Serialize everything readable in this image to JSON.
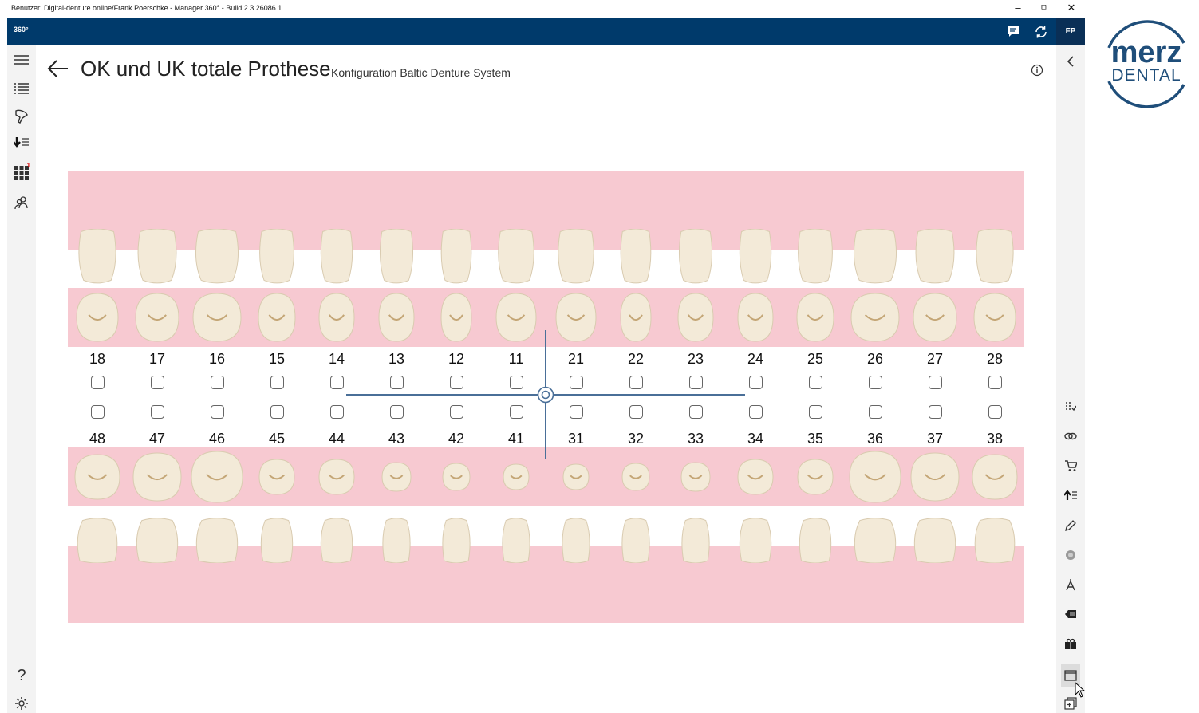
{
  "window": {
    "title": "Benutzer: Digital-denture.online/Frank Poerschke - Manager 360° - Build 2.3.26086.1",
    "controls": [
      "–",
      "⧉",
      "✕"
    ]
  },
  "appbar": {
    "logo_text": "360°",
    "user_initials": "FP",
    "icons": [
      "chat-icon",
      "sync-icon"
    ],
    "background": "#003a6b"
  },
  "left_rail": {
    "icons": [
      "hamburger-menu-icon",
      "list-icon",
      "dental-brush-icon",
      "download-list-icon",
      "grid-apps-icon",
      "users-icon",
      "help-icon",
      "settings-gear-icon"
    ],
    "grid_badge": "1"
  },
  "header": {
    "title": "OK und UK totale Prothese",
    "subtitle": "Konfiguration Baltic Denture System"
  },
  "upper_numbers": [
    "18",
    "17",
    "16",
    "15",
    "14",
    "13",
    "12",
    "11",
    "21",
    "22",
    "23",
    "24",
    "25",
    "26",
    "27",
    "28"
  ],
  "lower_numbers": [
    "48",
    "47",
    "46",
    "45",
    "44",
    "43",
    "42",
    "41",
    "31",
    "32",
    "33",
    "34",
    "35",
    "36",
    "37",
    "38"
  ],
  "right_rail": {
    "icons": [
      "collapse-chevron-icon",
      "checklist-icon",
      "link-icon",
      "cart-icon",
      "upload-list-icon",
      "edit-pencil-icon",
      "scan-icon",
      "compass-icon",
      "label-icon",
      "gift-icon",
      "window-icon",
      "add-window-icon"
    ]
  },
  "brand": {
    "merz": "merz",
    "dental": "DENTAL",
    "color": "#1f4e7a"
  },
  "colors": {
    "gum": "#f7c9d1",
    "tooth": "#f3ead8",
    "crosshair": "#4a6f98"
  }
}
